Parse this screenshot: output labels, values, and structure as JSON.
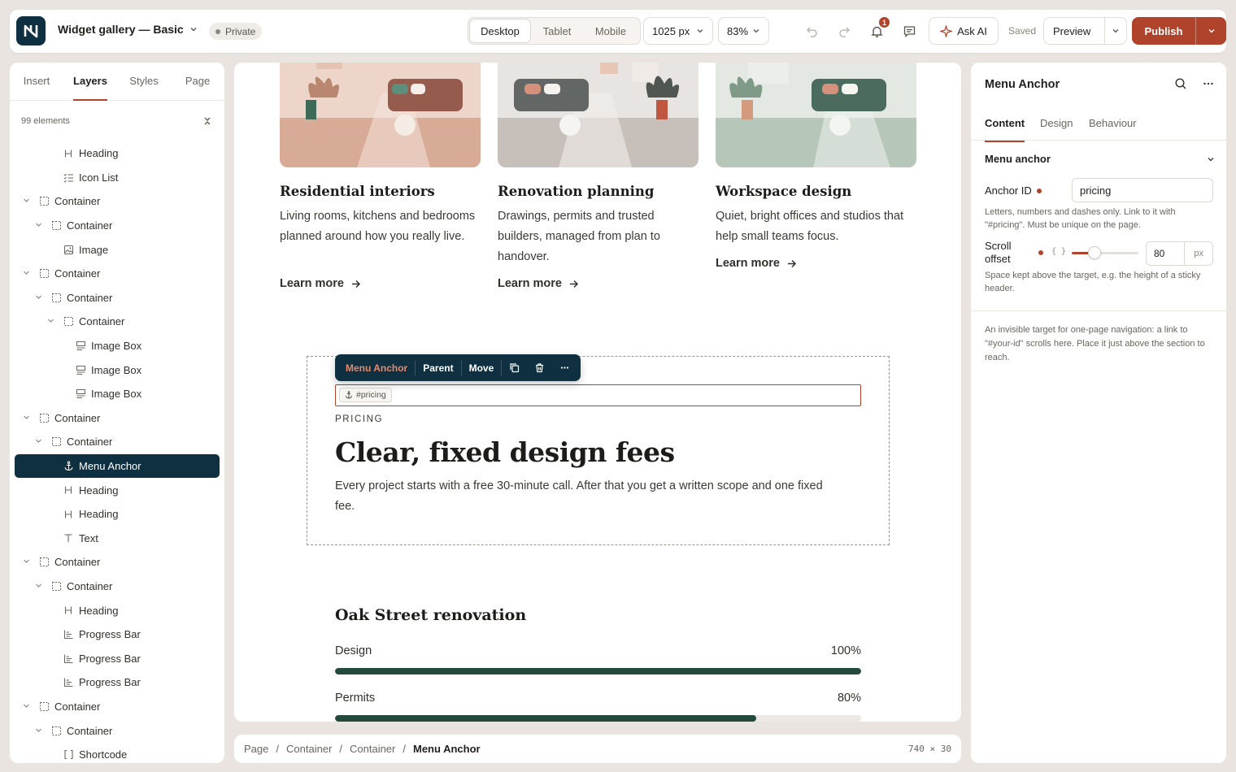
{
  "header": {
    "title": "Widget gallery — Basic",
    "privacy": "Private",
    "devices": [
      "Desktop",
      "Tablet",
      "Mobile"
    ],
    "active_device": "Desktop",
    "width": "1025 px",
    "zoom": "83%",
    "notification_count": "1",
    "ask_ai": "Ask AI",
    "saved": "Saved",
    "preview": "Preview",
    "publish": "Publish"
  },
  "left_panel": {
    "tabs": [
      "Insert",
      "Layers",
      "Styles",
      "Page"
    ],
    "active_tab": "Layers",
    "count": "99 elements",
    "layers": [
      {
        "label": "Heading",
        "icon": "heading-icon",
        "depth": 3,
        "expand": false
      },
      {
        "label": "Icon List",
        "icon": "icon-list-icon",
        "depth": 3,
        "expand": false
      },
      {
        "label": "Container",
        "icon": "container-icon",
        "depth": 1,
        "expand": true
      },
      {
        "label": "Container",
        "icon": "container-icon",
        "depth": 2,
        "expand": true
      },
      {
        "label": "Image",
        "icon": "image-icon",
        "depth": 3,
        "expand": false
      },
      {
        "label": "Container",
        "icon": "container-icon",
        "depth": 1,
        "expand": true
      },
      {
        "label": "Container",
        "icon": "container-icon",
        "depth": 2,
        "expand": true
      },
      {
        "label": "Container",
        "icon": "container-icon",
        "depth": 3,
        "expand": true
      },
      {
        "label": "Image Box",
        "icon": "image-box-icon",
        "depth": 4,
        "expand": false
      },
      {
        "label": "Image Box",
        "icon": "image-box-icon",
        "depth": 4,
        "expand": false
      },
      {
        "label": "Image Box",
        "icon": "image-box-icon",
        "depth": 4,
        "expand": false
      },
      {
        "label": "Container",
        "icon": "container-icon",
        "depth": 1,
        "expand": true
      },
      {
        "label": "Container",
        "icon": "container-icon",
        "depth": 2,
        "expand": true
      },
      {
        "label": "Menu Anchor",
        "icon": "anchor-icon",
        "depth": 3,
        "expand": false,
        "active": true
      },
      {
        "label": "Heading",
        "icon": "heading-icon",
        "depth": 3,
        "expand": false
      },
      {
        "label": "Heading",
        "icon": "heading-icon",
        "depth": 3,
        "expand": false
      },
      {
        "label": "Text",
        "icon": "text-icon",
        "depth": 3,
        "expand": false
      },
      {
        "label": "Container",
        "icon": "container-icon",
        "depth": 1,
        "expand": true
      },
      {
        "label": "Container",
        "icon": "container-icon",
        "depth": 2,
        "expand": true
      },
      {
        "label": "Heading",
        "icon": "heading-icon",
        "depth": 3,
        "expand": false
      },
      {
        "label": "Progress Bar",
        "icon": "progress-bar-icon",
        "depth": 3,
        "expand": false
      },
      {
        "label": "Progress Bar",
        "icon": "progress-bar-icon",
        "depth": 3,
        "expand": false
      },
      {
        "label": "Progress Bar",
        "icon": "progress-bar-icon",
        "depth": 3,
        "expand": false
      },
      {
        "label": "Container",
        "icon": "container-icon",
        "depth": 1,
        "expand": true
      },
      {
        "label": "Container",
        "icon": "container-icon",
        "depth": 2,
        "expand": true
      },
      {
        "label": "Shortcode",
        "icon": "shortcode-icon",
        "depth": 3,
        "expand": false
      }
    ]
  },
  "canvas": {
    "cards": [
      {
        "title": "Residential interiors",
        "desc": "Living rooms, kitchens and bedrooms planned around how you really live.",
        "link": "Learn more"
      },
      {
        "title": "Renovation planning",
        "desc": "Drawings, permits and trusted builders, managed from plan to handover.",
        "link": "Learn more"
      },
      {
        "title": "Workspace design",
        "desc": "Quiet, bright offices and studios that help small teams focus.",
        "link": "Learn more"
      }
    ],
    "toolbar": {
      "element": "Menu Anchor",
      "parent": "Parent",
      "move": "Move"
    },
    "anchor_pill": "#pricing",
    "pricing_label": "PRICING",
    "pricing_heading": "Clear, fixed design fees",
    "pricing_text": "Every project starts with a free 30-minute call. After that you get a written scope and one fixed fee.",
    "project_heading": "Oak Street renovation",
    "progress": [
      {
        "label": "Design",
        "value_text": "100%",
        "value": 100
      },
      {
        "label": "Permits",
        "value_text": "80%",
        "value": 80
      }
    ]
  },
  "breadcrumb": {
    "items": [
      "Page",
      "Container",
      "Container"
    ],
    "current": "Menu Anchor",
    "size": "740 × 30"
  },
  "right_panel": {
    "title": "Menu Anchor",
    "tabs": [
      "Content",
      "Design",
      "Behaviour"
    ],
    "active_tab": "Content",
    "section": "Menu anchor",
    "anchor_id_label": "Anchor ID",
    "anchor_id_value": "pricing",
    "anchor_help": "Letters, numbers and dashes only. Link to it with \"#pricing\". Must be unique on the page.",
    "scroll_label_1": "Scroll",
    "scroll_label_2": "offset",
    "scroll_value": "80",
    "scroll_unit": "px",
    "scroll_fraction": 0.12,
    "scroll_help": "Space kept above the target, e.g. the height of a sticky header.",
    "description": "An invisible target for one-page navigation: a link to \"#your-id\" scrolls here. Place it just above the section to reach."
  },
  "colors": {
    "accent": "#b0432b",
    "dark": "#0e3040",
    "progress": "#244a3e"
  }
}
